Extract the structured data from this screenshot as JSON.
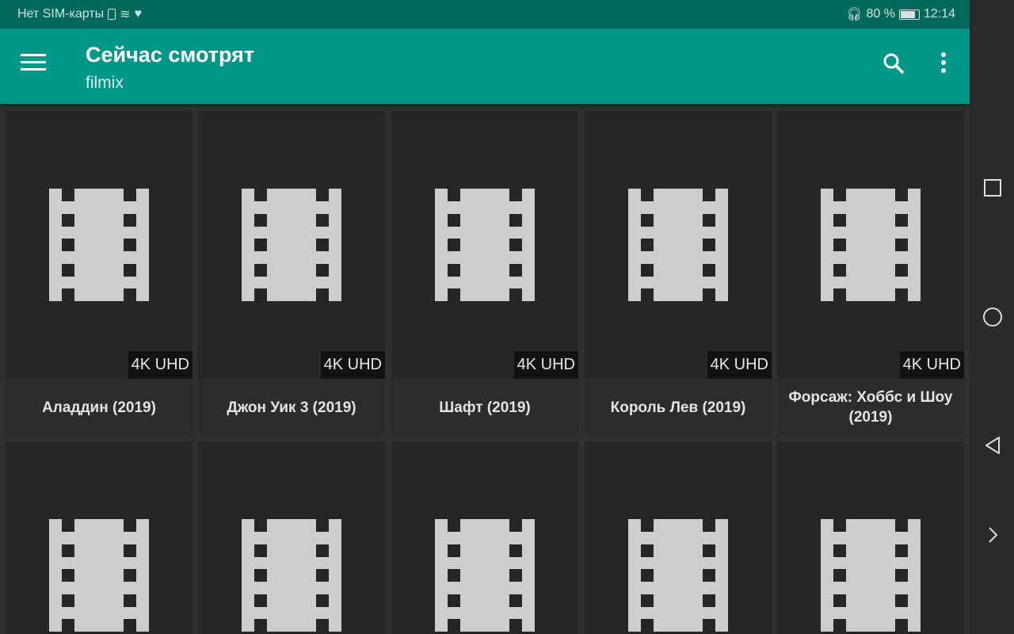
{
  "status": {
    "carrier": "Нет SIM-карты",
    "battery": "80 %",
    "time": "12:14"
  },
  "toolbar": {
    "title": "Сейчас смотрят",
    "subtitle": "filmix"
  },
  "colors": {
    "status_bar": "#00695c",
    "toolbar": "#009688",
    "background": "#303030"
  },
  "row1": [
    {
      "title": "Аладдин (2019)",
      "badge": "4K UHD"
    },
    {
      "title": "Джон Уик 3 (2019)",
      "badge": "4K UHD"
    },
    {
      "title": "Шафт (2019)",
      "badge": "4K UHD"
    },
    {
      "title": "Король Лев (2019)",
      "badge": "4K UHD"
    },
    {
      "title": "Форсаж: Хоббс и Шоу (2019)",
      "badge": "4K UHD"
    }
  ]
}
